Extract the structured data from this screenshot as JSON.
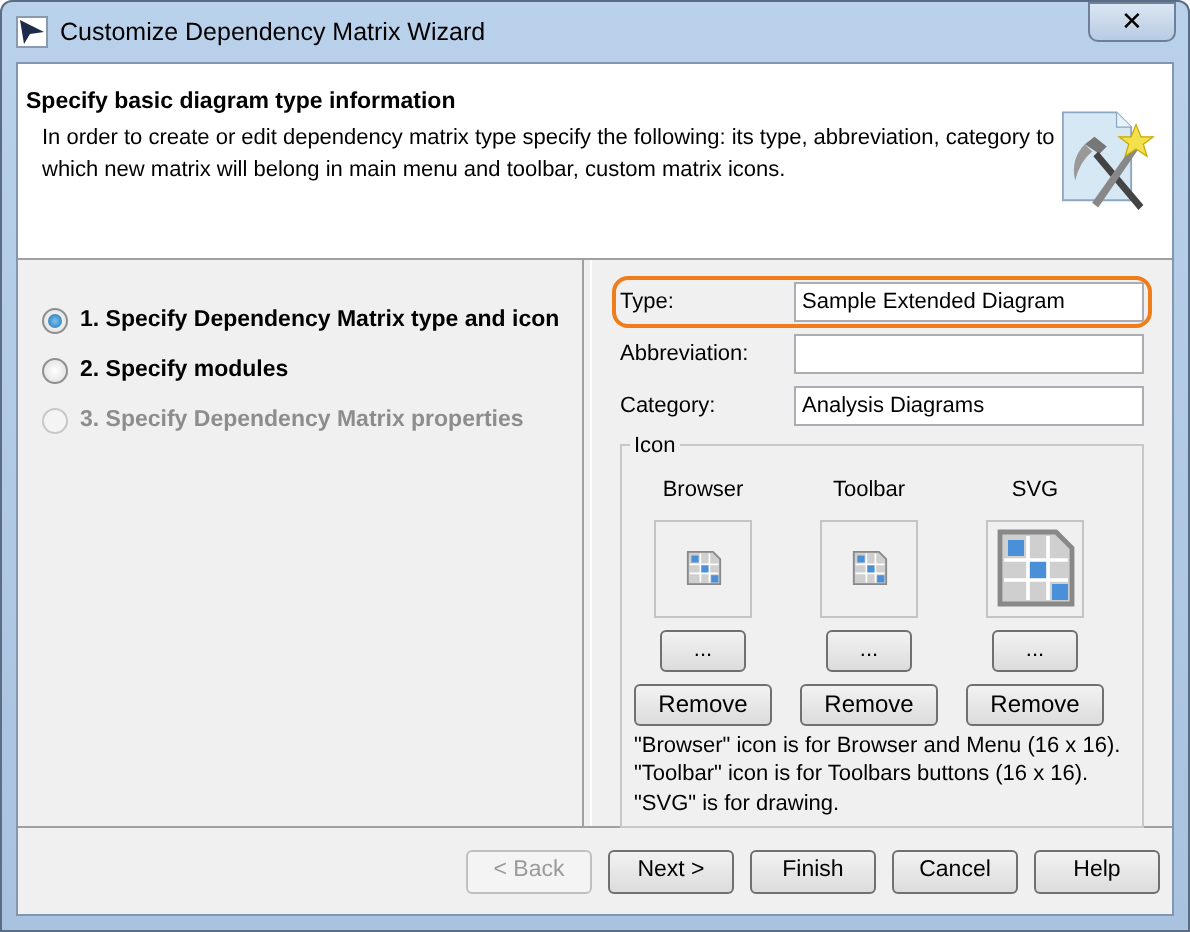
{
  "window": {
    "title": "Customize Dependency Matrix Wizard",
    "close_button": "✕"
  },
  "header": {
    "title": "Specify basic diagram type information",
    "description": "In order to create or edit dependency matrix type specify the following: its type, abbreviation, category to which new matrix will belong in main menu and toolbar, custom matrix icons."
  },
  "steps": [
    {
      "label": "1. Specify Dependency Matrix type and icon",
      "selected": true,
      "disabled": false
    },
    {
      "label": "2. Specify modules",
      "selected": false,
      "disabled": false
    },
    {
      "label": "3. Specify Dependency Matrix properties",
      "selected": false,
      "disabled": true
    }
  ],
  "fields": [
    {
      "label": "Type:",
      "value": "Sample Extended Diagram",
      "highlighted": true
    },
    {
      "label": "Abbreviation:",
      "highlighted": false
    },
    {
      "label": "Category:",
      "value": "Analysis Diagrams",
      "highlighted": false
    }
  ],
  "icon_group": {
    "title": "Icon",
    "columns": [
      {
        "label": "Browser",
        "kind": "small",
        "browse_button": "...",
        "remove_button": "Remove"
      },
      {
        "label": "Toolbar",
        "kind": "small",
        "browse_button": "...",
        "remove_button": "Remove"
      },
      {
        "label": "SVG",
        "kind": "large",
        "browse_button": "...",
        "remove_button": "Remove"
      }
    ],
    "notes": [
      "\"Browser\" icon is for Browser and Menu (16 x 16).",
      "\"Toolbar\" icon is for Toolbars buttons (16 x 16).",
      "\"SVG\" is for drawing."
    ]
  },
  "buttons": [
    {
      "label": "< Back",
      "disabled": true
    },
    {
      "label": "Next >",
      "disabled": false
    },
    {
      "label": "Finish",
      "disabled": false
    },
    {
      "label": "Cancel",
      "disabled": false
    },
    {
      "label": "Help",
      "disabled": false
    }
  ]
}
